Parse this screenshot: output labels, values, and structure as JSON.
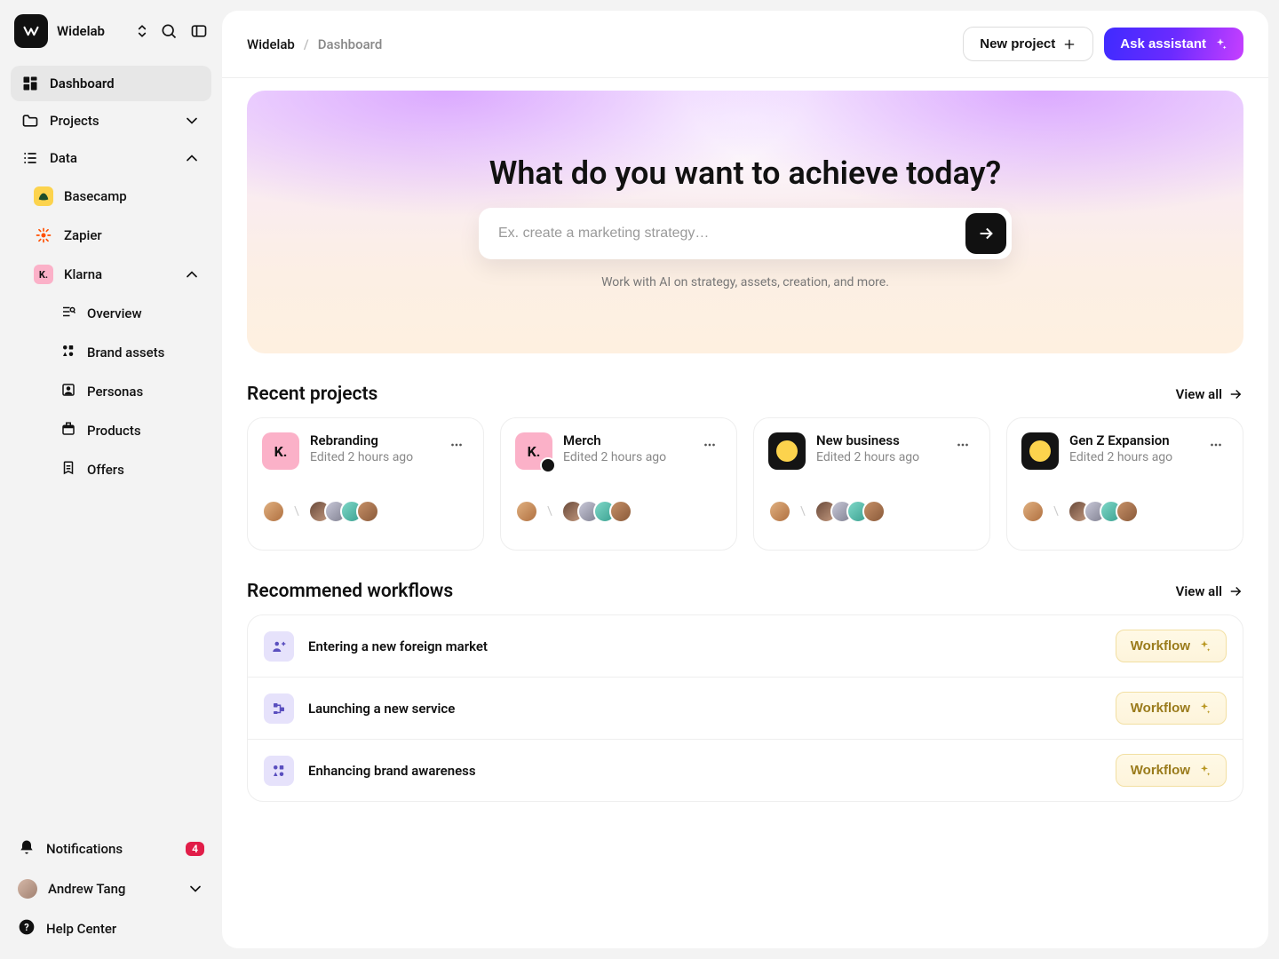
{
  "workspace": {
    "name": "Widelab"
  },
  "sidebar": {
    "nav": {
      "dashboard": "Dashboard",
      "projects": "Projects",
      "data": "Data"
    },
    "data_items": {
      "basecamp": "Basecamp",
      "zapier": "Zapier",
      "klarna": "Klarna"
    },
    "klarna_items": {
      "overview": "Overview",
      "brand_assets": "Brand assets",
      "personas": "Personas",
      "products": "Products",
      "offers": "Offers"
    },
    "bottom": {
      "notifications": "Notifications",
      "notif_count": "4",
      "user": "Andrew Tang",
      "help": "Help Center"
    }
  },
  "breadcrumb": {
    "root": "Widelab",
    "current": "Dashboard"
  },
  "topbar": {
    "new_project": "New project",
    "ask_assistant": "Ask assistant"
  },
  "hero": {
    "title": "What do you want to achieve today?",
    "placeholder": "Ex. create a marketing strategy…",
    "subtitle": "Work with AI on strategy, assets, creation, and more."
  },
  "sections": {
    "recent_title": "Recent projects",
    "recommended_title": "Recommened workflows",
    "view_all": "View all"
  },
  "projects": [
    {
      "title": "Rebranding",
      "subtitle": "Edited 2 hours ago",
      "icon": "klarna"
    },
    {
      "title": "Merch",
      "subtitle": "Edited 2 hours ago",
      "icon": "klarna-dark"
    },
    {
      "title": "New business",
      "subtitle": "Edited 2 hours ago",
      "icon": "dark-basecamp"
    },
    {
      "title": "Gen Z Expansion",
      "subtitle": "Edited 2 hours ago",
      "icon": "dark-basecamp"
    }
  ],
  "workflows": [
    {
      "title": "Entering a new foreign market",
      "button": "Workflow"
    },
    {
      "title": "Launching a new service",
      "button": "Workflow"
    },
    {
      "title": "Enhancing brand awareness",
      "button": "Workflow"
    }
  ]
}
